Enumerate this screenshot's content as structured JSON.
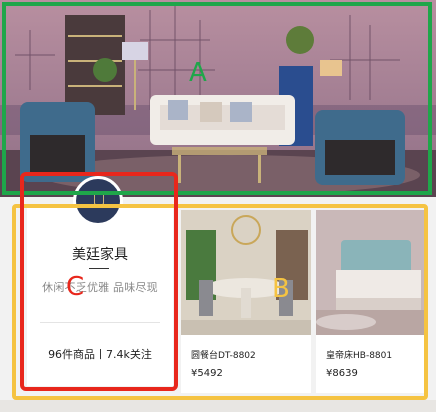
{
  "annotations": {
    "a": "A",
    "b": "B",
    "c": "C"
  },
  "store": {
    "name": "美廷家具",
    "slogan": "休闲不乏优雅 品味尽现",
    "stats": "96件商品丨7.4k关注"
  },
  "products": [
    {
      "name": "圆餐台DT-8802",
      "price": "¥5492"
    },
    {
      "name": "皇帝床HB-8801",
      "price": "¥8639"
    }
  ],
  "colors": {
    "box_a": "#1fa64a",
    "box_b": "#f5c342",
    "box_c": "#e8271c",
    "logo_bg": "#2c3a5c"
  }
}
